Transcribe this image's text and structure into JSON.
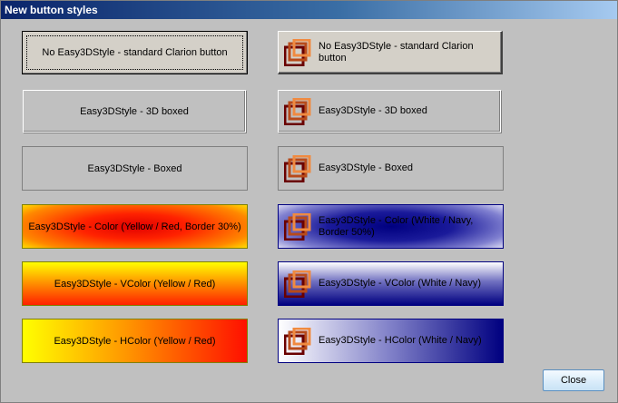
{
  "window": {
    "title": "New button styles"
  },
  "buttons": {
    "b1": "No Easy3DStyle - standard Clarion button",
    "b2": "No Easy3DStyle - standard Clarion button",
    "b3": "Easy3DStyle - 3D boxed",
    "b4": "Easy3DStyle - 3D boxed",
    "b5": "Easy3DStyle - Boxed",
    "b6": "Easy3DStyle - Boxed",
    "b7": "Easy3DStyle - Color (Yellow / Red, Border 30%)",
    "b8": "Easy3DStyle - Color (White / Navy, Border 50%)",
    "b9": "Easy3DStyle - VColor (Yellow / Red)",
    "b10": "Easy3DStyle - VColor (White / Navy)",
    "b11": "Easy3DStyle - HColor (Yellow / Red)",
    "b12": "Easy3DStyle - HColor (White / Navy)"
  },
  "close": {
    "label": "Close"
  },
  "icons": {
    "button_icon": "easy3d-frames-icon"
  },
  "colors": {
    "yellow": "#ffff00",
    "red": "#ff0000",
    "white": "#ffffff",
    "navy": "#000080",
    "dialog_bg": "#c0c0c0"
  }
}
